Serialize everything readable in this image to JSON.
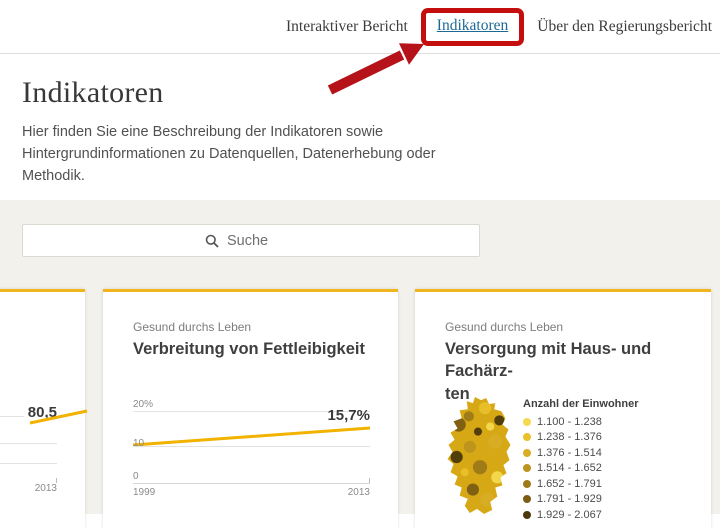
{
  "nav": {
    "items": [
      {
        "label": "Interaktiver Bericht"
      },
      {
        "label": "Indikatoren"
      },
      {
        "label": "Über den Regierungsbericht"
      }
    ]
  },
  "annotation": {
    "box_color": "#c50f0f",
    "arrow_color": "#b5121a"
  },
  "hero": {
    "title": "Indikatoren",
    "description": "Hier finden Sie eine Beschreibung der Indikatoren sowie Hintergrundinformationen zu Datenquellen, Datenerhebung oder Methodik."
  },
  "search": {
    "placeholder": "Suche"
  },
  "colors": {
    "accent_yellow": "#f0b41c",
    "line_yellow": "#f2b200",
    "map_base": "#d7a815",
    "link_blue": "#1d6994",
    "section_bg": "#f2f1ec"
  },
  "cards": [
    {
      "value": "80,5",
      "x_end": "2013"
    },
    {
      "category": "Gesund durchs Leben",
      "title": "Verbreitung von Fettleibigkeit",
      "value": "15,7%",
      "y_tick_top": "20%",
      "y_tick_mid": "10",
      "y_tick_bottom": "0",
      "x_start": "1999",
      "x_end": "2013"
    },
    {
      "category": "Gesund durchs Leben",
      "title_line1": "Versorgung mit Haus- und Fachärz-",
      "title_line2": "ten",
      "legend_title": "Anzahl der Einwohner",
      "legend": [
        {
          "label": "1.100 - 1.238",
          "color": "#f6d84f"
        },
        {
          "label": "1.238 - 1.376",
          "color": "#eac02b"
        },
        {
          "label": "1.376 - 1.514",
          "color": "#d9ad24"
        },
        {
          "label": "1.514 - 1.652",
          "color": "#bc941e"
        },
        {
          "label": "1.652 - 1.791",
          "color": "#9e7a19"
        },
        {
          "label": "1.791 - 1.929",
          "color": "#7c5c13"
        },
        {
          "label": "1.929 - 2.067",
          "color": "#4b380b"
        }
      ]
    }
  ],
  "chart_data": [
    {
      "type": "line",
      "note": "left card, partially visible",
      "end_value": 80.5,
      "x_end": 2013
    },
    {
      "type": "line",
      "title": "Verbreitung von Fettleibigkeit",
      "x": [
        1999,
        2013
      ],
      "values": [
        10.4,
        15.7
      ],
      "unit": "%",
      "ylim": [
        0,
        20
      ],
      "y_ticks": [
        0,
        10,
        20
      ]
    },
    {
      "type": "heatmap",
      "title": "Versorgung mit Haus- und Fachärzten",
      "legend_title": "Anzahl der Einwohner",
      "bins": [
        "1.100 - 1.238",
        "1.238 - 1.376",
        "1.376 - 1.514",
        "1.514 - 1.652",
        "1.652 - 1.791",
        "1.791 - 1.929",
        "1.929 - 2.067"
      ]
    }
  ]
}
